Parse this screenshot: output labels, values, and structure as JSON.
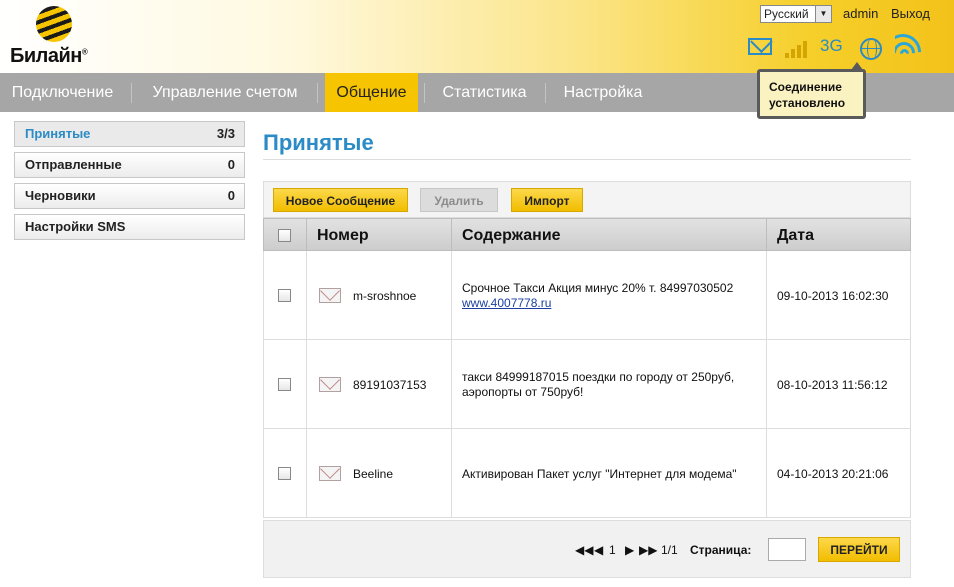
{
  "header": {
    "logo_text": "Билайн",
    "logo_mark": "®",
    "language": "Русский",
    "user": "admin",
    "logout": "Выход",
    "network_type": "3G",
    "icons": [
      "mail-icon",
      "signal-strength-icon",
      "globe-icon",
      "wifi-icon"
    ]
  },
  "tooltip": {
    "line1": "Соединение",
    "line2": "установлено"
  },
  "nav": {
    "items": [
      {
        "label": "Подключение"
      },
      {
        "label": "Управление счетом"
      },
      {
        "label": "Общение"
      },
      {
        "label": "Статистика"
      },
      {
        "label": "Настройка"
      }
    ],
    "active": "Общение"
  },
  "sidebar": {
    "items": [
      {
        "label": "Принятые",
        "count": "3/3"
      },
      {
        "label": "Отправленные",
        "count": "0"
      },
      {
        "label": "Черновики",
        "count": "0"
      },
      {
        "label": "Настройки SMS",
        "count": ""
      }
    ]
  },
  "main": {
    "title": "Принятые",
    "toolbar": {
      "new_message": "Новое Сообщение",
      "delete": "Удалить",
      "import": "Импорт"
    },
    "columns": {
      "number": "Номер",
      "content": "Содержание",
      "date": "Дата"
    },
    "rows": [
      {
        "number": "m-sroshnoe",
        "content": "Срочное Такси Акция минус 20% т. 84997030502",
        "link": "www.4007778.ru",
        "date": "09-10-2013 16:02:30"
      },
      {
        "number": "89191037153",
        "content": "такси 84999187015 поездки по городу от 250руб, аэропорты от 750руб!",
        "link": "",
        "date": "08-10-2013 11:56:12"
      },
      {
        "number": "Beeline",
        "content": "Активирован Пакет услуг \"Интернет для модема\"",
        "link": "",
        "date": "04-10-2013 20:21:06"
      }
    ]
  },
  "pagination": {
    "current": "1",
    "total": "1/1",
    "page_label": "Страница:",
    "page_value": "",
    "go_button": "ПЕРЕЙТИ"
  },
  "colors": {
    "accent": "#f6c400",
    "title_blue": "#2a8bc6",
    "nav_gray": "#a6a6a6"
  }
}
